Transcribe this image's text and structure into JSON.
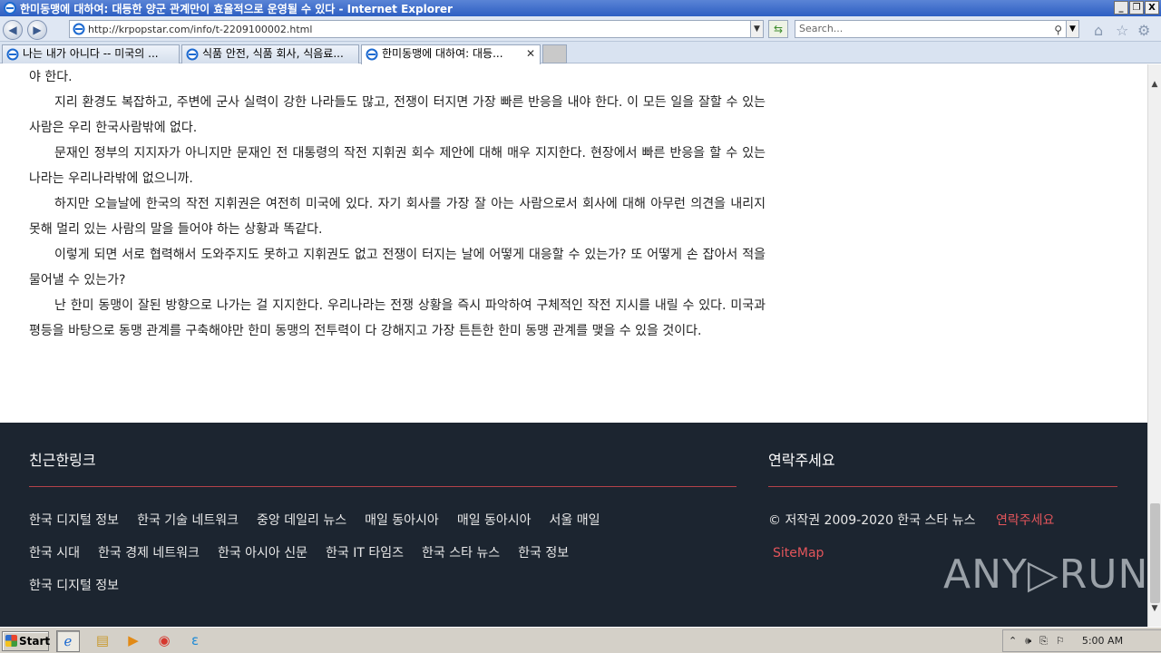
{
  "window": {
    "title": "한미동맹에 대하여: 대등한 양군 관계만이 효율적으로 운영될 수 있다 - Internet Explorer",
    "minimize": "_",
    "restore": "❐",
    "close": "X"
  },
  "nav": {
    "back_icon": "back-arrow-icon",
    "forward_icon": "forward-arrow-icon",
    "back_glyph": "◀",
    "forward_glyph": "▶",
    "address": "http://krpopstar.com/info/t-2209100002.html",
    "address_drop": "▼",
    "refresh_glyph": "⇆",
    "search_placeholder": "Search...",
    "search_glyph": "⚲",
    "search_drop": "▼",
    "home_glyph": "⌂",
    "fav_glyph": "☆",
    "gear_glyph": "⚙"
  },
  "tabs": [
    {
      "label": "나는 내가 아니다 -- 미국의 ...",
      "active": false
    },
    {
      "label": "식품 안전, 식품 회사, 식음료...",
      "active": false
    },
    {
      "label": "한미동맹에 대하여: 대등...",
      "active": true,
      "close": "✕"
    }
  ],
  "article": {
    "paragraphs": [
      "야 한다.",
      "지리 환경도 복잡하고, 주변에 군사 실력이 강한 나라들도 많고, 전쟁이 터지면 가장 빠른 반응을 내야 한다. 이 모든 일을 잘할 수 있는 사람은 우리 한국사람밖에 없다.",
      "문재인 정부의 지지자가 아니지만 문재인 전 대통령의 작전 지휘권 회수 제안에 대해 매우 지지한다. 현장에서 빠른 반응을 할 수 있는 나라는 우리나라밖에 없으니까.",
      "하지만 오늘날에 한국의 작전 지휘권은 여전히 미국에 있다. 자기 회사를 가장 잘 아는 사람으로서 회사에 대해 아무런 의견을 내리지 못해 멀리 있는 사람의 말을 들어야 하는 상황과 똑같다.",
      "이렇게 되면 서로 협력해서 도와주지도 못하고 지휘권도 없고 전쟁이 터지는 날에 어떻게 대응할 수 있는가? 또 어떻게 손 잡아서 적을 물어낼 수 있는가?",
      "난 한미 동맹이 잘된 방향으로 나가는 걸 지지한다. 우리나라는 전쟁 상황을 즉시 파악하여 구체적인 작전 지시를 내릴 수 있다. 미국과 평등을 바탕으로 동맹 관계를 구축해야만 한미 동맹의 전투력이 다 강해지고 가장 튼튼한 한미 동맹 관계를 맺을 수 있을 것이다."
    ]
  },
  "footer": {
    "links_title": "친근한링크",
    "links": [
      "한국 디지털 정보",
      "한국 기술 네트워크",
      "중앙 데일리 뉴스",
      "매일 동아시아",
      "매일 동아시아",
      "서울 매일",
      "한국 시대",
      "한국 경제 네트워크",
      "한국 아시아 신문",
      "한국 IT 타임즈",
      "한국 스타 뉴스",
      "한국 정보",
      "한국 디지털 정보"
    ],
    "contact_title": "연락주세요",
    "copyright": "© 저작권 2009-2020 한국 스타 뉴스",
    "contact_link": "연락주세요",
    "sitemap": "SiteMap",
    "accent_color": "#e3555b",
    "background_color": "#1c2530"
  },
  "scrollbar": {
    "up": "▲",
    "down": "▼"
  },
  "watermark": "ANY▷RUN",
  "taskbar": {
    "start_label": "Start",
    "apps": [
      {
        "name": "ie",
        "glyph": "ℯ"
      },
      {
        "name": "explorer",
        "glyph": "▤"
      },
      {
        "name": "media",
        "glyph": "▶"
      },
      {
        "name": "chrome",
        "glyph": "◉"
      },
      {
        "name": "edge",
        "glyph": "ε"
      }
    ],
    "tray": {
      "expand": "⌃",
      "volume": "🕪",
      "network": "⎘",
      "flag": "⚐",
      "clock": "5:00 AM"
    }
  }
}
